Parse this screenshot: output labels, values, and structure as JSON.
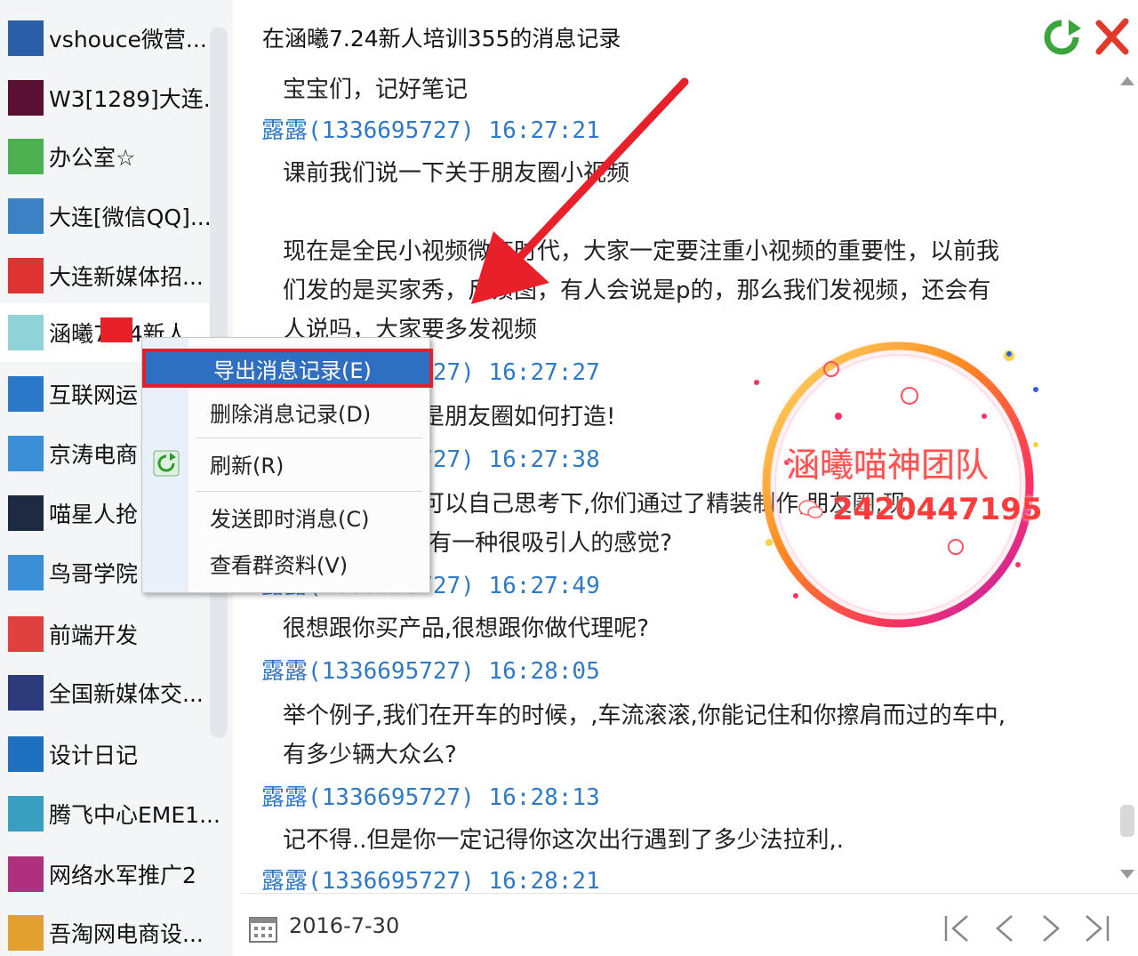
{
  "sidebar": {
    "groups": [
      {
        "name": "vshouce微营...",
        "icon": "vshouce-avatar",
        "color": "#2a5fa8"
      },
      {
        "name": "W3[1289]大连...",
        "icon": "w3-avatar",
        "color": "#5a1030"
      },
      {
        "name": "办公室☆",
        "icon": "office-avatar",
        "color": "#4caf50"
      },
      {
        "name": "大连[微信QQ]...",
        "icon": "dalian-avatar",
        "color": "#3b82c4"
      },
      {
        "name": "大连新媒体招...",
        "icon": "newmedia-avatar",
        "color": "#d33"
      },
      {
        "name": "涵曦7.24新人",
        "icon": "hanxi-avatar",
        "color": "#8fd3d8"
      },
      {
        "name": "互联网运",
        "icon": "internet-avatar",
        "color": "#2b77c8"
      },
      {
        "name": "京涛电商",
        "icon": "jingtao-avatar",
        "color": "#3b8fd6"
      },
      {
        "name": "喵星人抢",
        "icon": "cat-avatar",
        "color": "#1e2a40"
      },
      {
        "name": "鸟哥学院",
        "icon": "bird-avatar",
        "color": "#3b8fd6"
      },
      {
        "name": "前端开发",
        "icon": "frontend-avatar",
        "color": "#e04040"
      },
      {
        "name": "全国新媒体交...",
        "icon": "national-avatar",
        "color": "#2e3b7a"
      },
      {
        "name": "设计日记",
        "icon": "design-avatar",
        "color": "#1f6fc0"
      },
      {
        "name": "腾飞中心EME1...",
        "icon": "tengfei-avatar",
        "color": "#3a9ec0"
      },
      {
        "name": "网络水军推广2",
        "icon": "network-avatar",
        "color": "#b03080"
      },
      {
        "name": "吾淘网电商设...",
        "icon": "wutao-avatar",
        "color": "#e2a030"
      }
    ]
  },
  "header": {
    "title": "在涵曦7.24新人培训355的消息记录",
    "refresh_icon": "green-refresh-icon",
    "close_icon": "red-close-icon"
  },
  "messages": [
    {
      "type": "body",
      "text": "宝宝们，记好笔记"
    },
    {
      "type": "sender",
      "text": "露露(1336695727) 16:27:21"
    },
    {
      "type": "body",
      "text": "课前我们说一下关于朋友圈小视频"
    },
    {
      "type": "body",
      "text": "现在是全民小视频微商时代，大家一定要注重小视频的重要性，以前我"
    },
    {
      "type": "body",
      "text": "们发的是买家秀，反馈图，有人会说是p的，那么我们发视频，还会有"
    },
    {
      "type": "body",
      "text": "人说吗，大家要多发视频"
    },
    {
      "type": "sender",
      "text": "露露(1336695727) 16:27:27"
    },
    {
      "type": "body",
      "text": "今天主要讲的是朋友圈如何打造!"
    },
    {
      "type": "sender",
      "text": "露露(1336695727) 16:27:38"
    },
    {
      "type": "body",
      "text": "那么我想大家可以自己思考下,你们通过了精装制作,朋友圈,现"
    },
    {
      "type": "body",
      "text": "在看起来,有没有一种很吸引人的感觉?"
    },
    {
      "type": "sender",
      "text": "露露(1336695727) 16:27:49"
    },
    {
      "type": "body",
      "text": "很想跟你买产品,很想跟你做代理呢?"
    },
    {
      "type": "sender",
      "text": "露露(1336695727) 16:28:05"
    },
    {
      "type": "body",
      "text": "举个例子,我们在开车的时候，,车流滚滚,你能记住和你擦肩而过的车中,"
    },
    {
      "type": "body",
      "text": "有多少辆大众么?"
    },
    {
      "type": "sender",
      "text": "露露(1336695727) 16:28:13"
    },
    {
      "type": "body",
      "text": "记不得..但是你一定记得你这次出行遇到了多少法拉利,."
    },
    {
      "type": "sender",
      "text": "露露(1336695727) 16:28:21"
    }
  ],
  "footer": {
    "date": "2016-7-30",
    "calendar_icon": "calendar-icon",
    "nav": [
      "first-page-icon",
      "prev-page-icon",
      "next-page-icon",
      "last-page-icon"
    ]
  },
  "context_menu": {
    "items": [
      "导出消息记录(E)",
      "删除消息记录(D)",
      "刷新(R)",
      "发送即时消息(C)",
      "查看群资料(V)"
    ],
    "highlighted": 0
  },
  "watermark": {
    "team": "涵曦喵神团队",
    "number": "2420447195",
    "colors": {
      "ring_outer": "#ff9a20",
      "ring_inner": "#b030d0",
      "text": "#ff4040"
    }
  },
  "annotation": {
    "arrow_color": "#e8202a"
  }
}
